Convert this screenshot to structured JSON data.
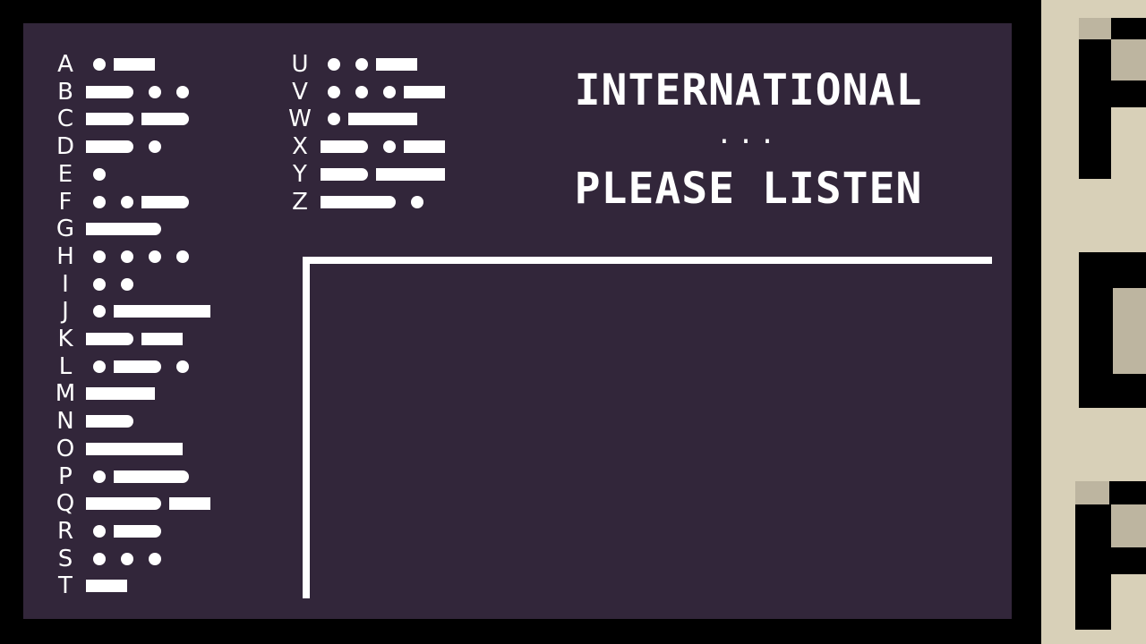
{
  "colors": {
    "background": "#000000",
    "screen": "#32263a",
    "text": "#ffffff",
    "side_panel": "#d8d0b8",
    "side_shade": "#bdb5a0"
  },
  "header": {
    "line1": "INTERNATIONAL",
    "line2": "...",
    "line3": "PLEASE LISTEN"
  },
  "morse_chart": {
    "left_column": [
      {
        "letter": "A",
        "code": ".-"
      },
      {
        "letter": "B",
        "code": "-..."
      },
      {
        "letter": "C",
        "code": "-.-."
      },
      {
        "letter": "D",
        "code": "-.."
      },
      {
        "letter": "E",
        "code": "."
      },
      {
        "letter": "F",
        "code": "..-."
      },
      {
        "letter": "G",
        "code": "--."
      },
      {
        "letter": "H",
        "code": "...."
      },
      {
        "letter": "I",
        "code": ".."
      },
      {
        "letter": "J",
        "code": ".---"
      },
      {
        "letter": "K",
        "code": "-.-"
      },
      {
        "letter": "L",
        "code": ".-.."
      },
      {
        "letter": "M",
        "code": "--"
      },
      {
        "letter": "N",
        "code": "-."
      },
      {
        "letter": "O",
        "code": "---"
      },
      {
        "letter": "P",
        "code": ".--."
      },
      {
        "letter": "Q",
        "code": "--.-"
      },
      {
        "letter": "R",
        "code": ".-."
      },
      {
        "letter": "S",
        "code": "..."
      },
      {
        "letter": "T",
        "code": "-"
      }
    ],
    "right_column": [
      {
        "letter": "U",
        "code": "..-"
      },
      {
        "letter": "V",
        "code": "...-"
      },
      {
        "letter": "W",
        "code": ".--"
      },
      {
        "letter": "X",
        "code": "-..-"
      },
      {
        "letter": "Y",
        "code": "-.--"
      },
      {
        "letter": "Z",
        "code": "--.."
      }
    ]
  },
  "answer_area": {
    "content": ""
  },
  "side_panel": {
    "symbols": [
      "pixel-glyph-top-icon",
      "pixel-glyph-middle-icon",
      "pixel-glyph-bottom-icon"
    ]
  }
}
